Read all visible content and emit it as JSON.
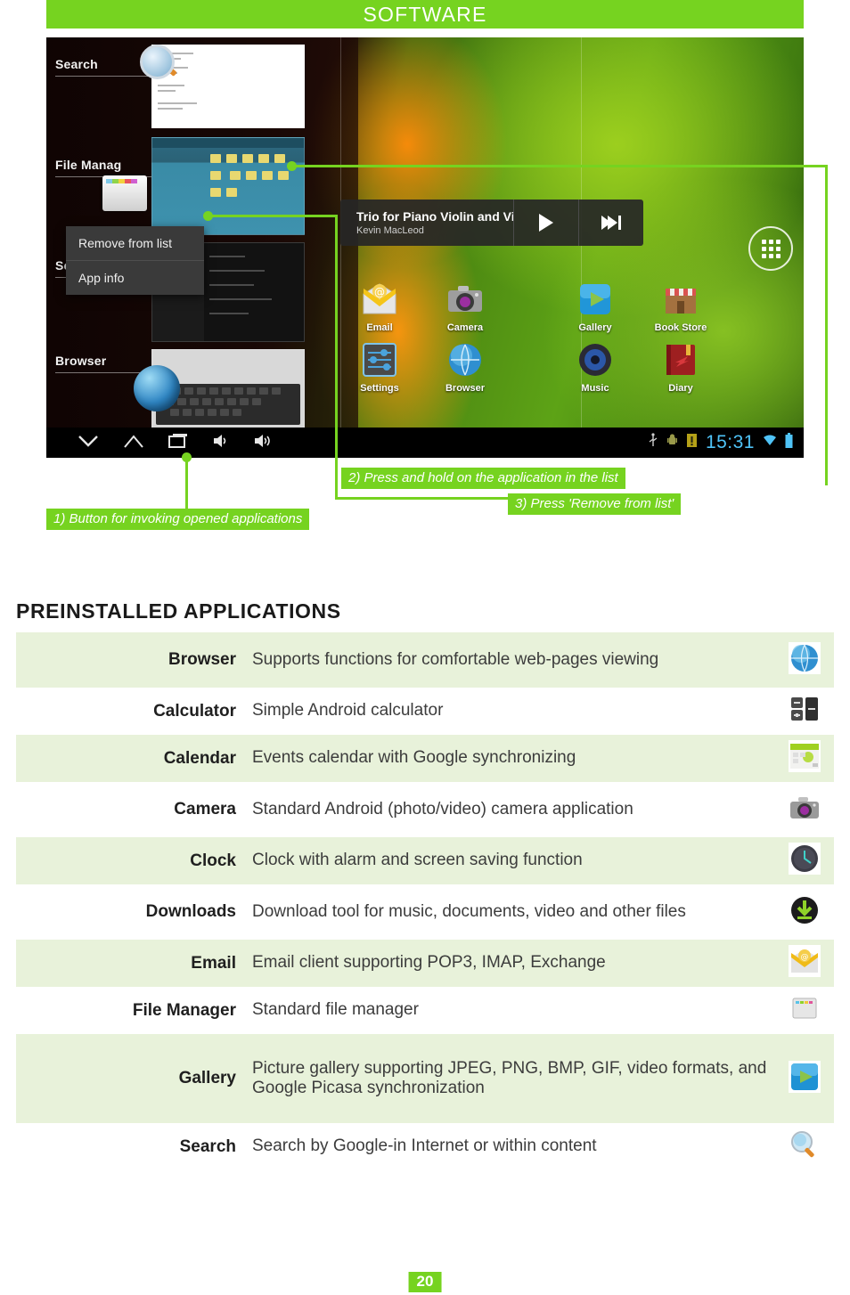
{
  "header": {
    "title": "SOFTWARE"
  },
  "colors": {
    "accent_green": "#76d320",
    "row_green": "#e8f2da",
    "callout_text": "#ffffff"
  },
  "screenshot": {
    "recent_apps": [
      {
        "label": "Search"
      },
      {
        "label": "File Manag"
      },
      {
        "label": "Settings"
      },
      {
        "label": "Browser"
      }
    ],
    "context_menu": {
      "items": [
        {
          "label": "Remove from list"
        },
        {
          "label": "App info"
        }
      ]
    },
    "music_widget": {
      "track": "Trio for Piano Violin and Vi",
      "artist": "Kevin MacLeod",
      "play_icon": "play-icon",
      "next_icon": "next-track-icon"
    },
    "home_icons": [
      {
        "label": "Email",
        "icon": "email-icon"
      },
      {
        "label": "Camera",
        "icon": "camera-icon"
      },
      {
        "label": "Gallery",
        "icon": "gallery-icon"
      },
      {
        "label": "Book Store",
        "icon": "book-store-icon"
      },
      {
        "label": "Settings",
        "icon": "settings-icon"
      },
      {
        "label": "Browser",
        "icon": "browser-icon"
      },
      {
        "label": "Music",
        "icon": "music-icon"
      },
      {
        "label": "Diary",
        "icon": "diary-icon"
      }
    ],
    "drawer_button": {
      "icon": "app-drawer-icon"
    },
    "navbar": {
      "left_icons": [
        "back-icon",
        "home-icon",
        "recent-apps-icon",
        "volume-down-icon",
        "volume-up-icon"
      ],
      "right_icons": [
        "usb-icon",
        "android-icon",
        "warning-icon"
      ],
      "clock": "15:31",
      "trailing_icons": [
        "wifi-icon",
        "battery-icon"
      ]
    },
    "callouts": [
      {
        "id": "callout-1",
        "text": "1) Button for invoking opened applications"
      },
      {
        "id": "callout-2",
        "text": "2) Press and hold on the application in the list"
      },
      {
        "id": "callout-3",
        "text": "3) Press 'Remove from list'"
      }
    ]
  },
  "section": {
    "title": "PREINSTALLED APPLICATIONS"
  },
  "apps_table": {
    "rows": [
      {
        "name": "Browser",
        "desc": "Supports functions for comfortable web-pages viewing",
        "icon": "browser-globe-icon"
      },
      {
        "name": "Calculator",
        "desc": "Simple Android calculator",
        "icon": "calculator-icon"
      },
      {
        "name": "Calendar",
        "desc": "Events calendar with Google synchronizing",
        "icon": "calendar-icon"
      },
      {
        "name": "Camera",
        "desc": "Standard Android (photo/video) camera application",
        "icon": "camera-icon"
      },
      {
        "name": "Clock",
        "desc": "Clock with alarm and screen saving function",
        "icon": "clock-icon"
      },
      {
        "name": "Downloads",
        "desc": "Download tool for music, documents, video and other files",
        "icon": "downloads-icon"
      },
      {
        "name": "Email",
        "desc": "Email client supporting POP3, IMAP, Exchange",
        "icon": "email-icon"
      },
      {
        "name": "File Manager",
        "desc": "Standard file manager",
        "icon": "file-manager-icon"
      },
      {
        "name": "Gallery",
        "desc": "Picture gallery supporting JPEG, PNG, BMP, GIF, video formats, and Google Picasa synchronization",
        "icon": "gallery-icon"
      },
      {
        "name": "Search",
        "desc": "Search by Google-in Internet or within content",
        "icon": "search-magnifier-icon"
      }
    ]
  },
  "footer": {
    "page_number": "20"
  }
}
